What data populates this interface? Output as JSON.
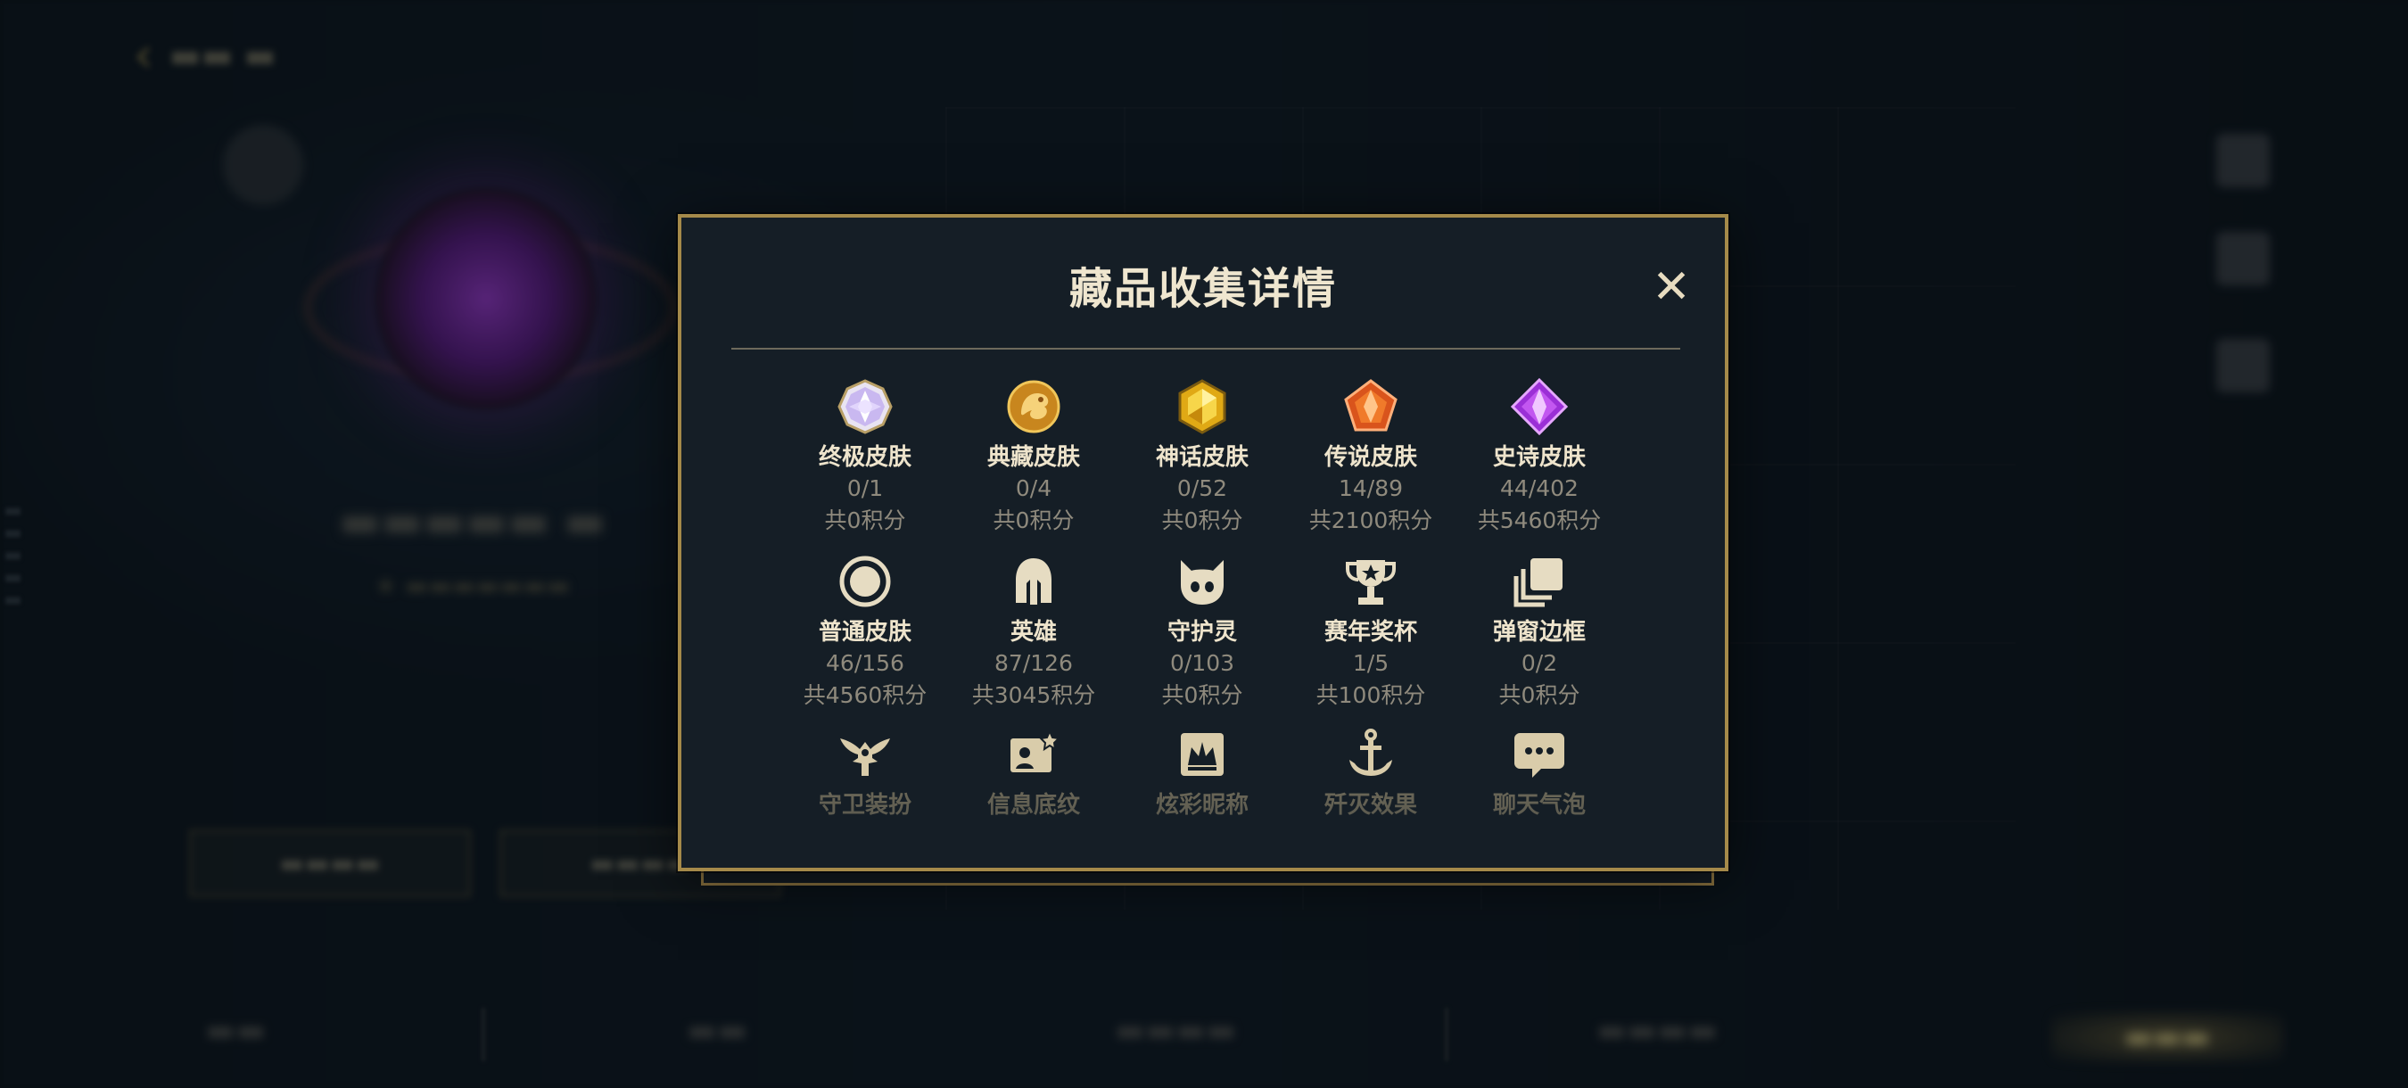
{
  "modal": {
    "title": "藏品收集详情",
    "close_label": "✕",
    "items": [
      {
        "name": "终极皮肤",
        "count": "0/1",
        "points": "共0积分",
        "icon": "ultimate-skin-icon"
      },
      {
        "name": "典藏皮肤",
        "count": "0/4",
        "points": "共0积分",
        "icon": "collector-skin-icon"
      },
      {
        "name": "神话皮肤",
        "count": "0/52",
        "points": "共0积分",
        "icon": "mythic-skin-icon"
      },
      {
        "name": "传说皮肤",
        "count": "14/89",
        "points": "共2100积分",
        "icon": "legendary-skin-icon"
      },
      {
        "name": "史诗皮肤",
        "count": "44/402",
        "points": "共5460积分",
        "icon": "epic-skin-icon"
      },
      {
        "name": "普通皮肤",
        "count": "46/156",
        "points": "共4560积分",
        "icon": "normal-skin-icon"
      },
      {
        "name": "英雄",
        "count": "87/126",
        "points": "共3045积分",
        "icon": "hero-helmet-icon"
      },
      {
        "name": "守护灵",
        "count": "0/103",
        "points": "共0积分",
        "icon": "guardian-spirit-icon"
      },
      {
        "name": "赛年奖杯",
        "count": "1/5",
        "points": "共100积分",
        "icon": "trophy-icon"
      },
      {
        "name": "弹窗边框",
        "count": "0/2",
        "points": "共0积分",
        "icon": "popup-frame-icon"
      },
      {
        "name": "守卫装扮",
        "icon": "ward-skin-icon"
      },
      {
        "name": "信息底纹",
        "icon": "info-card-icon"
      },
      {
        "name": "炫彩昵称",
        "icon": "colorful-nickname-icon"
      },
      {
        "name": "歼灭效果",
        "icon": "annihilation-effect-icon"
      },
      {
        "name": "聊天气泡",
        "icon": "chat-bubble-icon"
      }
    ]
  },
  "colors": {
    "accent_gold": "#a58a4a",
    "modal_bg": "#151e26",
    "title_text": "#efe6cf",
    "sub_text": "#8f8a7d"
  }
}
